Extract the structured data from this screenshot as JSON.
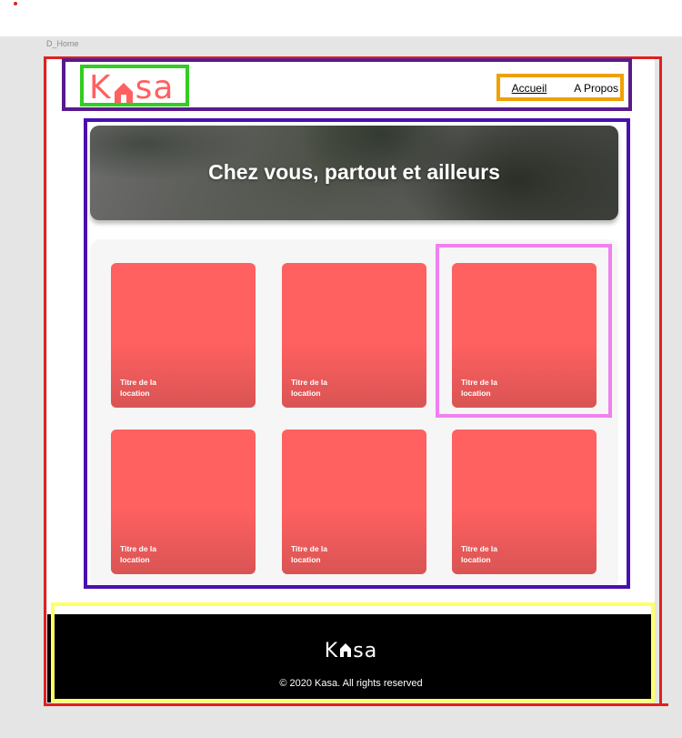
{
  "frame_label": "D_Home",
  "header": {
    "logo_left": "K",
    "logo_right": "sa",
    "nav": [
      {
        "label": "Accueil",
        "active": true
      },
      {
        "label": "A Propos",
        "active": false
      }
    ]
  },
  "banner": {
    "title": "Chez vous, partout et ailleurs"
  },
  "gallery": {
    "cards": [
      {
        "title": "Titre de la location"
      },
      {
        "title": "Titre de la location"
      },
      {
        "title": "Titre de la location"
      },
      {
        "title": "Titre de la location"
      },
      {
        "title": "Titre de la location"
      },
      {
        "title": "Titre de la location"
      }
    ]
  },
  "footer": {
    "logo_left": "K",
    "logo_right": "sa",
    "copyright": "© 2020 Kasa. All rights reserved"
  },
  "colors": {
    "brand": "#ff6060",
    "footer_bg": "#000000",
    "canvas_bg": "#e5e5e5",
    "annotation_red": "#e02020",
    "annotation_purple": "#5a1a8c",
    "annotation_green": "#33cc22",
    "annotation_orange": "#f0a000",
    "annotation_blue": "#4a0fb0",
    "annotation_pink": "#f080f0",
    "annotation_yellow": "#ffff66"
  }
}
